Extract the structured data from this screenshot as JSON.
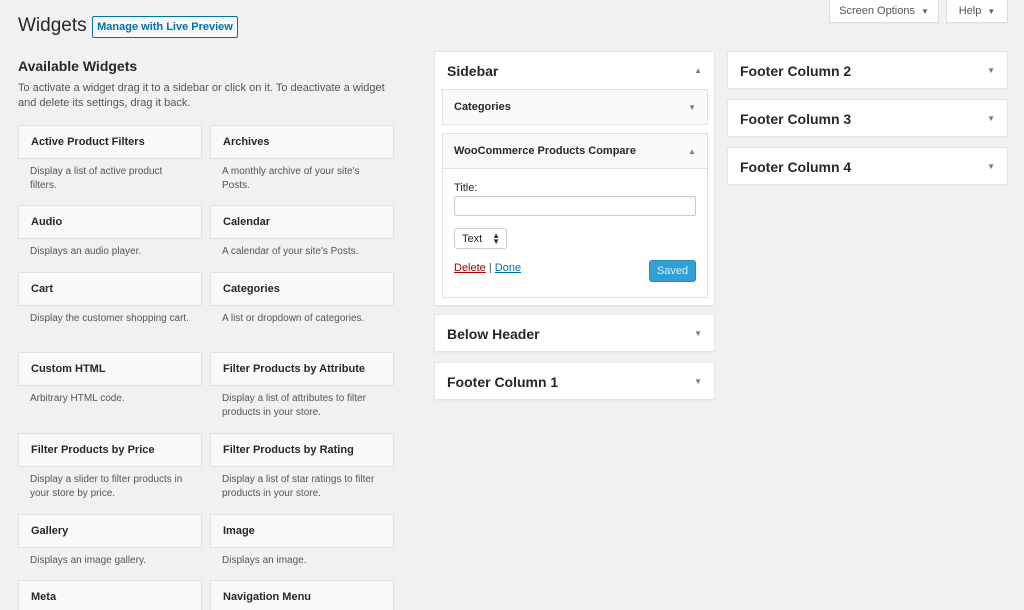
{
  "top_tabs": {
    "screen_options": "Screen Options",
    "help": "Help"
  },
  "header": {
    "title": "Widgets",
    "live_preview_button": "Manage with Live Preview"
  },
  "available": {
    "heading": "Available Widgets",
    "description": "To activate a widget drag it to a sidebar or click on it. To deactivate a widget and delete its settings, drag it back.",
    "widgets": [
      {
        "name": "Active Product Filters",
        "desc": "Display a list of active product filters."
      },
      {
        "name": "Archives",
        "desc": "A monthly archive of your site's Posts."
      },
      {
        "name": "Audio",
        "desc": "Displays an audio player."
      },
      {
        "name": "Calendar",
        "desc": "A calendar of your site's Posts."
      },
      {
        "name": "Cart",
        "desc": "Display the customer shopping cart."
      },
      {
        "name": "Categories",
        "desc": "A list or dropdown of categories."
      },
      {
        "name": "Custom HTML",
        "desc": "Arbitrary HTML code."
      },
      {
        "name": "Filter Products by Attribute",
        "desc": "Display a list of attributes to filter products in your store."
      },
      {
        "name": "Filter Products by Price",
        "desc": "Display a slider to filter products in your store by price."
      },
      {
        "name": "Filter Products by Rating",
        "desc": "Display a list of star ratings to filter products in your store."
      },
      {
        "name": "Gallery",
        "desc": "Displays an image gallery."
      },
      {
        "name": "Image",
        "desc": "Displays an image."
      },
      {
        "name": "Meta",
        "desc": ""
      },
      {
        "name": "Navigation Menu",
        "desc": ""
      }
    ]
  },
  "sidebar_panel": {
    "title": "Sidebar",
    "widgets": {
      "categories": "Categories",
      "compare": {
        "title": "WooCommerce Products Compare",
        "field_label": "Title:",
        "title_value": "",
        "select_value": "Text",
        "delete_link": "Delete",
        "separator": "|",
        "done_link": "Done",
        "saved_button": "Saved"
      }
    }
  },
  "areas": {
    "below_header": "Below Header",
    "footer_1": "Footer Column 1",
    "footer_2": "Footer Column 2",
    "footer_3": "Footer Column 3",
    "footer_4": "Footer Column 4"
  },
  "colors": {
    "accent": "#0073aa",
    "delete": "#aa0000",
    "saved_button": "#31a0d4",
    "background": "#f1f1f1"
  }
}
